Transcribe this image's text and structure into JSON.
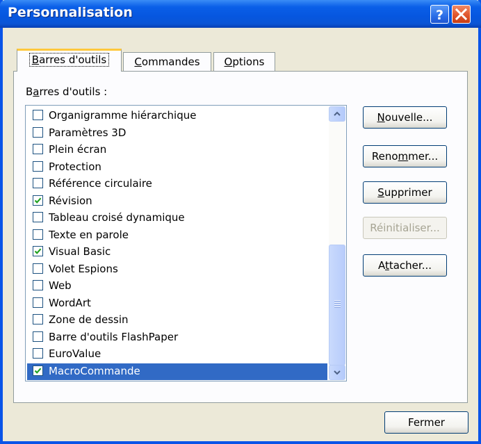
{
  "window": {
    "title": "Personnalisation"
  },
  "titlebar_buttons": {
    "help": "?",
    "close": "close"
  },
  "tabs": [
    {
      "label": "Barres d'outils",
      "active": true
    },
    {
      "label": "Commandes",
      "active": false
    },
    {
      "label": "Options",
      "active": false
    }
  ],
  "toolbars_label": "Barres d'outils :",
  "toolbars": [
    {
      "label": "Organigramme hiérarchique",
      "checked": false
    },
    {
      "label": "Paramètres 3D",
      "checked": false
    },
    {
      "label": "Plein écran",
      "checked": false
    },
    {
      "label": "Protection",
      "checked": false
    },
    {
      "label": "Référence circulaire",
      "checked": false
    },
    {
      "label": "Révision",
      "checked": true
    },
    {
      "label": "Tableau croisé dynamique",
      "checked": false
    },
    {
      "label": "Texte en parole",
      "checked": false
    },
    {
      "label": "Visual Basic",
      "checked": true
    },
    {
      "label": "Volet Espions",
      "checked": false
    },
    {
      "label": "Web",
      "checked": false
    },
    {
      "label": "WordArt",
      "checked": false
    },
    {
      "label": "Zone de dessin",
      "checked": false
    },
    {
      "label": "Barre d'outils FlashPaper",
      "checked": false
    },
    {
      "label": "EuroValue",
      "checked": false
    },
    {
      "label": "MacroCommande",
      "checked": true,
      "selected": true
    }
  ],
  "buttons": {
    "new": "Nouvelle...",
    "rename": "Renommer...",
    "delete": "Supprimer",
    "reset": "Réinitialiser...",
    "attach": "Attacher...",
    "close": "Fermer"
  },
  "colors": {
    "titlebar": "#0a5fe8",
    "selection": "#316ac5",
    "check": "#21a121",
    "active_tab_accent": "#ffc83c"
  }
}
